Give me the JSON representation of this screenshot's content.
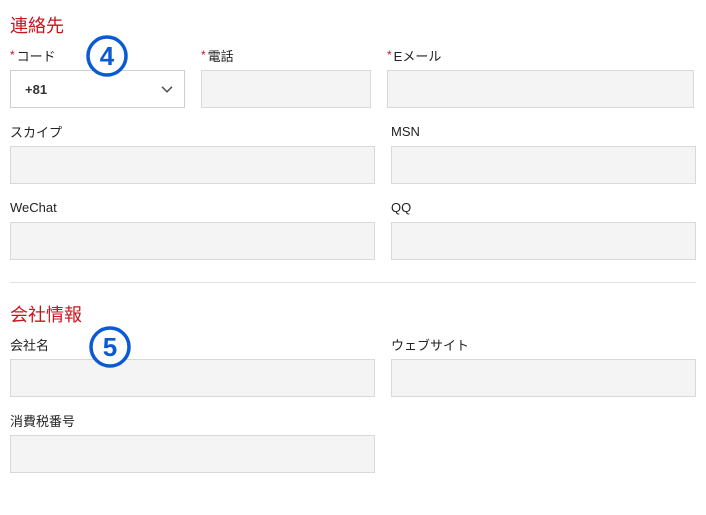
{
  "sections": {
    "contact": {
      "title": "連絡先",
      "code": {
        "label": "コード",
        "required": true,
        "value": "+81"
      },
      "phone": {
        "label": "電話",
        "required": true,
        "value": ""
      },
      "email": {
        "label": "Eメール",
        "required": true,
        "value": ""
      },
      "skype": {
        "label": "スカイプ",
        "value": ""
      },
      "msn": {
        "label": "MSN",
        "value": ""
      },
      "wechat": {
        "label": "WeChat",
        "value": ""
      },
      "qq": {
        "label": "QQ",
        "value": ""
      }
    },
    "company": {
      "title": "会社情報",
      "name": {
        "label": "会社名",
        "value": ""
      },
      "website": {
        "label": "ウェブサイト",
        "value": ""
      },
      "vat": {
        "label": "消費税番号",
        "value": ""
      }
    }
  },
  "annotations": {
    "marker4": "4",
    "marker5": "5",
    "circle_color": "#0a5bd3"
  },
  "required_marker": "*"
}
